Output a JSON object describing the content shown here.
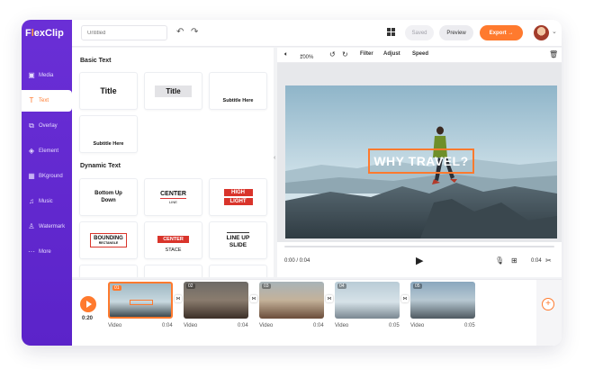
{
  "app": {
    "logo_prefix": "F",
    "logo_x": "lex",
    "logo_rest": "Clip"
  },
  "sidebar": {
    "items": [
      {
        "label": "Media",
        "icon": "media-icon"
      },
      {
        "label": "Text",
        "icon": "text-icon"
      },
      {
        "label": "Overlay",
        "icon": "overlay-icon"
      },
      {
        "label": "Element",
        "icon": "element-icon"
      },
      {
        "label": "BKground",
        "icon": "background-icon"
      },
      {
        "label": "Music",
        "icon": "music-icon"
      },
      {
        "label": "Watermark",
        "icon": "watermark-icon"
      },
      {
        "label": "More",
        "icon": "more-icon"
      }
    ],
    "active_index": 1
  },
  "topbar": {
    "title_placeholder": "Untitled",
    "saved_label": "Saved",
    "preview_label": "Preview",
    "export_label": "Export →"
  },
  "panel": {
    "basic_title": "Basic Text",
    "basic": {
      "title1": "Title",
      "title2": "Title",
      "subtitle1": "Subtitle Here",
      "subtitle2": "Subtitle Here"
    },
    "dynamic_title": "Dynamic Text",
    "dynamic": {
      "bottom_up": "Bottom Up",
      "down": "Down",
      "center": "CENTER",
      "line": "LINE",
      "high": "HIGH",
      "light": "LIGHT",
      "bounding": "BOUNDING",
      "rectangle": "RECTANGLE",
      "center2": "CENTER",
      "stace": "STACE",
      "line_up": "LINE UP",
      "slide": "SLIDE"
    }
  },
  "editor": {
    "zoom": "100%",
    "tools": {
      "filter": "Filter",
      "adjust": "Adjust",
      "speed": "Speed"
    },
    "overlay_text": "WHY TRAVEL?",
    "time_current": "0:00 / 0:04",
    "time_right": "0:04",
    "progress": 0
  },
  "timeline": {
    "total_time": "0:20",
    "clips": [
      {
        "num": "01",
        "label": "Video",
        "duration": "0:04"
      },
      {
        "num": "02",
        "label": "Video",
        "duration": "0:04"
      },
      {
        "num": "03",
        "label": "Video",
        "duration": "0:04"
      },
      {
        "num": "04",
        "label": "Video",
        "duration": "0:05"
      },
      {
        "num": "05",
        "label": "Video",
        "duration": "0:05"
      }
    ]
  },
  "colors": {
    "accent": "#ff7a2e",
    "sidebar": "#5b23c9",
    "red_text": "#d9342b"
  }
}
